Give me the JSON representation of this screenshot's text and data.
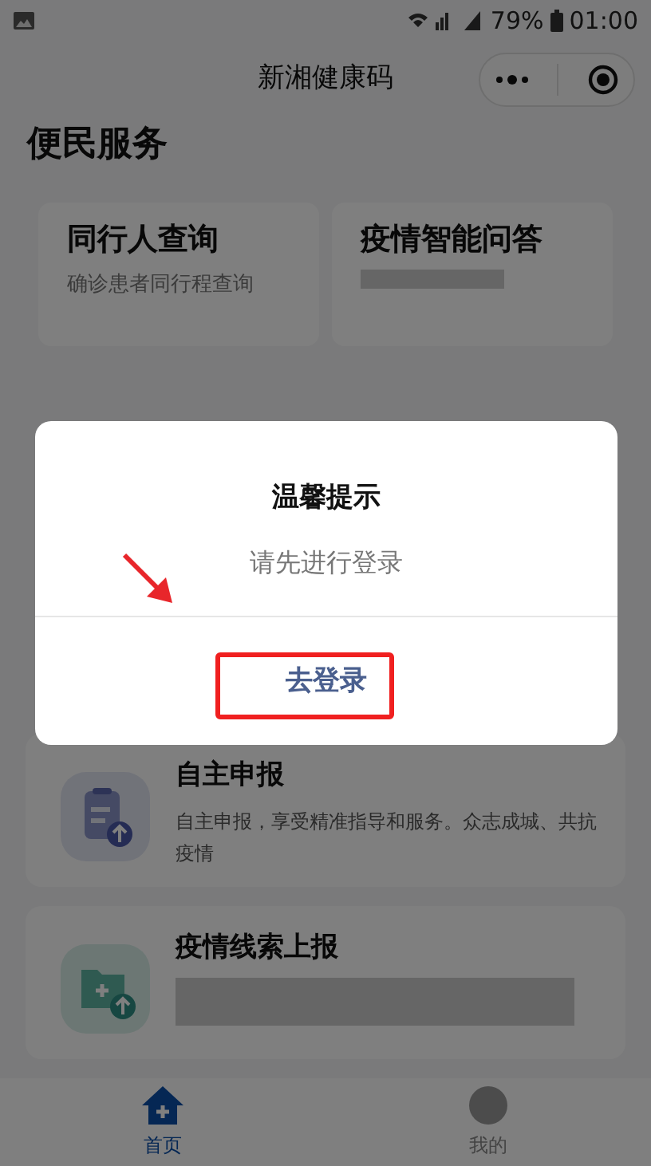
{
  "status_bar": {
    "battery": "79%",
    "time": "01:00"
  },
  "nav_bar": {
    "title": "新湘健康码"
  },
  "section_title": "便民服务",
  "service_cards": [
    {
      "title": "同行人查询",
      "subtitle": "确诊患者同行程查询",
      "redacted": false
    },
    {
      "title": "疫情智能问答",
      "redacted": true
    }
  ],
  "report_items": [
    {
      "title": "自主申报",
      "description": "自主申报，享受精准指导和服务。众志成城、共抗疫情",
      "kind": "clipboard",
      "redacted": false
    },
    {
      "title": "疫情线索上报",
      "kind": "folder",
      "redacted": true
    }
  ],
  "tab_bar": [
    {
      "label": "首页",
      "selected": true
    },
    {
      "label": "我的",
      "selected": false
    }
  ],
  "dialog": {
    "title": "温馨提示",
    "message": "请先进行登录",
    "button": "去登录"
  },
  "annotations": {
    "arrow": true,
    "highlight_box": true
  }
}
